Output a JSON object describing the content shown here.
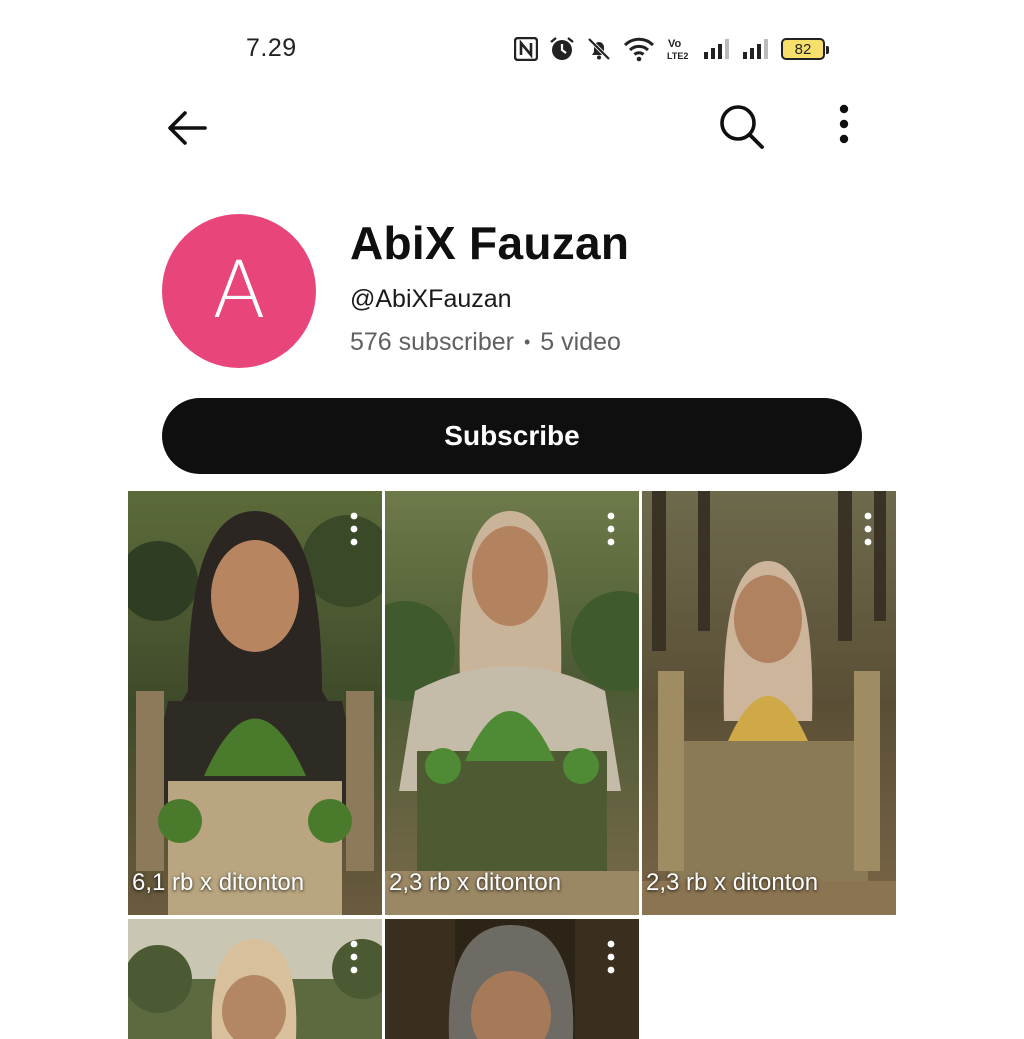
{
  "status_bar": {
    "time": "7.29",
    "icons": [
      "nfc-icon",
      "alarm-icon",
      "mute-icon",
      "wifi-icon",
      "volte-icon",
      "signal-icon",
      "signal-icon"
    ],
    "volte_label": "Vo LTE2",
    "battery_level": "82",
    "battery_color": "#f6df6a"
  },
  "app_bar": {
    "icons": [
      "back-arrow-icon",
      "search-icon",
      "more-vert-icon"
    ]
  },
  "channel": {
    "avatar_letter": "A",
    "avatar_color": "#e8467a",
    "name": "AbiX Fauzan",
    "handle": "@AbiXFauzan",
    "subscribers": "576 subscriber",
    "separator": "•",
    "videos": "5 video"
  },
  "subscribe_button": {
    "label": "Subscribe",
    "color": "#0f0f0f"
  },
  "shorts": [
    {
      "views": "6,1 rb x ditonton",
      "dome_color": "#4a7a2c"
    },
    {
      "views": "2,3 rb x ditonton",
      "dome_color": "#4f8a34"
    },
    {
      "views": "2,3 rb x ditonton",
      "dome_color": "#cfa848"
    },
    {
      "views": "",
      "dome_color": ""
    },
    {
      "views": "",
      "dome_color": ""
    }
  ]
}
